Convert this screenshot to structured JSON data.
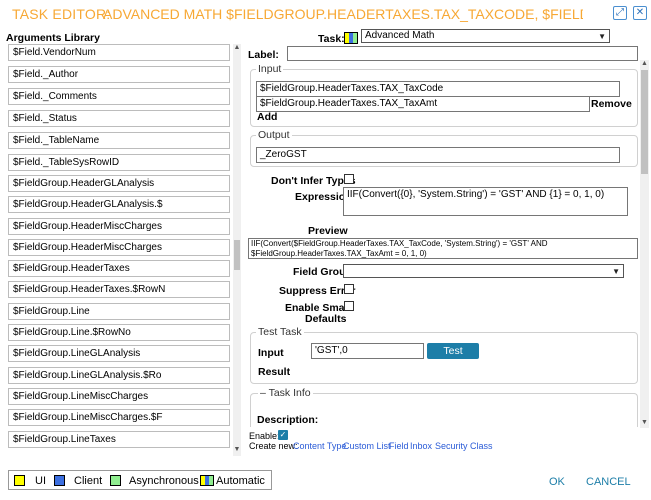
{
  "header": {
    "title_prefix": "TASK EDITOR:",
    "title_rest": "ADVANCED MATH $FIELDGROUP.HEADERTAXES.TAX_TAXCODE, $FIELDGROUP.HE...",
    "icons": [
      "maximize-icon",
      "close-icon"
    ]
  },
  "library": {
    "title": "Arguments Library",
    "items": [
      "$Field.VendorNum",
      "$Field._Author",
      "$Field._Comments",
      "$Field._Status",
      "$Field._TableName",
      "$Field._TableSysRowID",
      "$FieldGroup.HeaderGLAnalysis",
      "$FieldGroup.HeaderGLAnalysis.$",
      "$FieldGroup.HeaderMiscCharges",
      "$FieldGroup.HeaderMiscCharges",
      "$FieldGroup.HeaderTaxes",
      "$FieldGroup.HeaderTaxes.$RowN",
      "$FieldGroup.Line",
      "$FieldGroup.Line.$RowNo",
      "$FieldGroup.LineGLAnalysis",
      "$FieldGroup.LineGLAnalysis.$Ro",
      "$FieldGroup.LineMiscCharges",
      "$FieldGroup.LineMiscCharges.$F",
      "$FieldGroup.LineTaxes"
    ]
  },
  "task": {
    "label": "Task:",
    "value": "Advanced Math",
    "icon": "automatic-icon"
  },
  "label_field": {
    "label": "Label:",
    "value": ""
  },
  "input_group": {
    "legend": "Input",
    "values": [
      "$FieldGroup.HeaderTaxes.TAX_TaxCode",
      "$FieldGroup.HeaderTaxes.TAX_TaxAmt"
    ],
    "remove_label": "Remove",
    "add_label": "Add"
  },
  "output_group": {
    "legend": "Output",
    "value": "_ZeroGST"
  },
  "dont_infer": {
    "label": "Don't Infer Types"
  },
  "expression": {
    "label": "Expression",
    "value": "IIF(Convert({0}, 'System.String') = 'GST' AND {1} = 0, 1, 0)"
  },
  "preview": {
    "label": "Preview",
    "line1": "IIF(Convert($FieldGroup.HeaderTaxes.TAX_TaxCode, 'System.String') = 'GST' AND",
    "line2": "$FieldGroup.HeaderTaxes.TAX_TaxAmt = 0, 1, 0)"
  },
  "field_group": {
    "label": "Field Group",
    "value": ""
  },
  "suppress_error": {
    "label": "Suppress Error"
  },
  "smart_defaults": {
    "label_line1": "Enable Smart",
    "label_line2": "Defaults"
  },
  "test_task": {
    "legend": "Test Task",
    "input_label": "Input",
    "input_value": "'GST',0",
    "test_button": "Test",
    "result_label": "Result"
  },
  "task_info": {
    "legend": "Task Info",
    "collapse_glyph": "–",
    "description_label": "Description:"
  },
  "enable": {
    "label": "Enable:",
    "checked": true
  },
  "create_new": {
    "label": "Create new:",
    "links": [
      "Content Type",
      "Custom List",
      "Field",
      "Inbox",
      "Security Class"
    ]
  },
  "legend": {
    "items": [
      {
        "label": "UI",
        "color": "#ffff00"
      },
      {
        "label": "Client",
        "color": "#3c6fe0"
      },
      {
        "label": "Asynchronous",
        "color": "#90ee90"
      },
      {
        "label": "Automatic",
        "color": "automatic"
      }
    ]
  },
  "footer": {
    "ok": "OK",
    "cancel": "CANCEL"
  },
  "colors": {
    "accent_orange": "#f7a834",
    "teal": "#1d7ea8",
    "link_blue": "#2a5bd7"
  }
}
